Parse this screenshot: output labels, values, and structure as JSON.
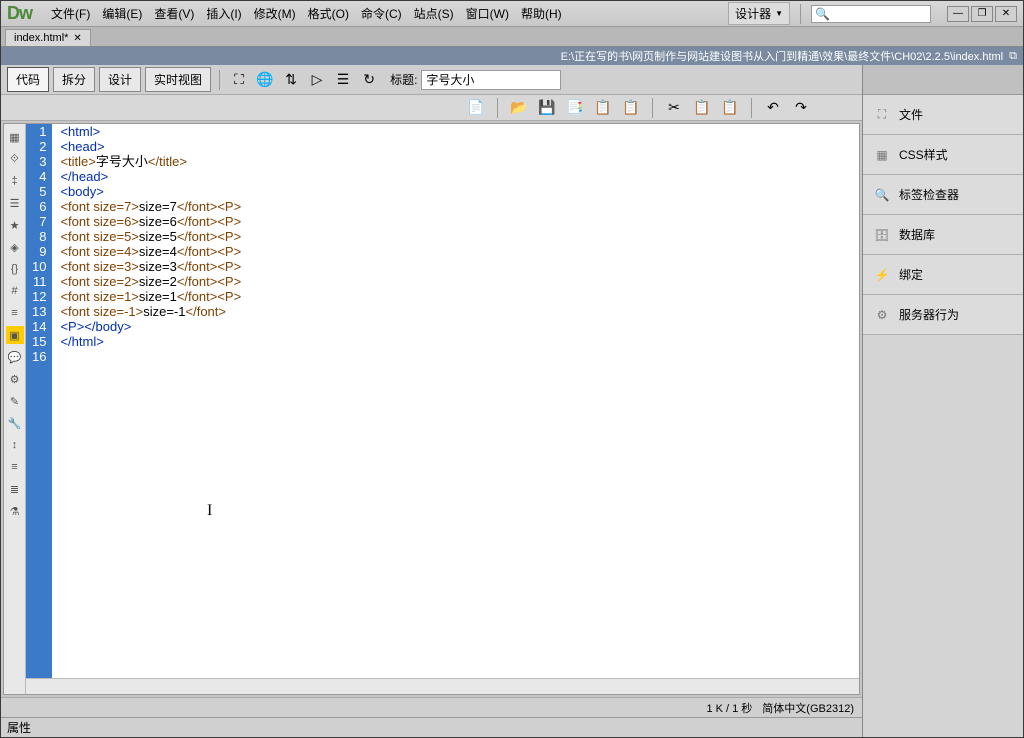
{
  "logo": "Dw",
  "menu": [
    "文件(F)",
    "编辑(E)",
    "查看(V)",
    "插入(I)",
    "修改(M)",
    "格式(O)",
    "命令(C)",
    "站点(S)",
    "窗口(W)",
    "帮助(H)"
  ],
  "designer_label": "设计器",
  "tab_name": "index.html*",
  "path": "E:\\正在写的书\\网页制作与网站建设图书从入门到精通\\效果\\最终文件\\CH02\\2.2.5\\index.html",
  "view_buttons": {
    "code": "代码",
    "split": "拆分",
    "design": "设计",
    "live": "实时视图"
  },
  "title_label": "标题:",
  "title_value": "字号大小",
  "status": {
    "size": "1 K / 1 秒",
    "encoding": "简体中文(GB2312)"
  },
  "props_label": "属性",
  "panels": [
    "文件",
    "CSS样式",
    "标签检查器",
    "数据库",
    "绑定",
    "服务器行为"
  ],
  "code_lines": [
    {
      "n": 1,
      "t": "<html>",
      "c": "blue"
    },
    {
      "n": 2,
      "t": "<head>",
      "c": "blue"
    },
    {
      "n": 3,
      "pre": "<title>",
      "mid": "字号大小",
      "post": "</title>"
    },
    {
      "n": 4,
      "t": "</head>",
      "c": "blue"
    },
    {
      "n": 5,
      "t": "<body>",
      "c": "blue"
    },
    {
      "n": 6,
      "pre": "<font size=7>",
      "mid": "size=7",
      "post": "</font><P>"
    },
    {
      "n": 7,
      "pre": "<font size=6>",
      "mid": "size=6",
      "post": "</font><P>"
    },
    {
      "n": 8,
      "pre": "<font size=5>",
      "mid": "size=5",
      "post": "</font><P>"
    },
    {
      "n": 9,
      "pre": "<font size=4>",
      "mid": "size=4",
      "post": "</font><P>"
    },
    {
      "n": 10,
      "pre": "<font size=3>",
      "mid": "size=3",
      "post": "</font><P>"
    },
    {
      "n": 11,
      "pre": "<font size=2>",
      "mid": "size=2",
      "post": "</font><P>"
    },
    {
      "n": 12,
      "pre": "<font size=1>",
      "mid": "size=1",
      "post": "</font><P>"
    },
    {
      "n": 13,
      "pre": "<font size=-1>",
      "mid": "size=-1",
      "post": "</font>"
    },
    {
      "n": 14,
      "t": "<P></body>",
      "c": "blue"
    },
    {
      "n": 15,
      "t": "</html>",
      "c": "blue"
    },
    {
      "n": 16,
      "t": "",
      "c": "blue"
    }
  ]
}
